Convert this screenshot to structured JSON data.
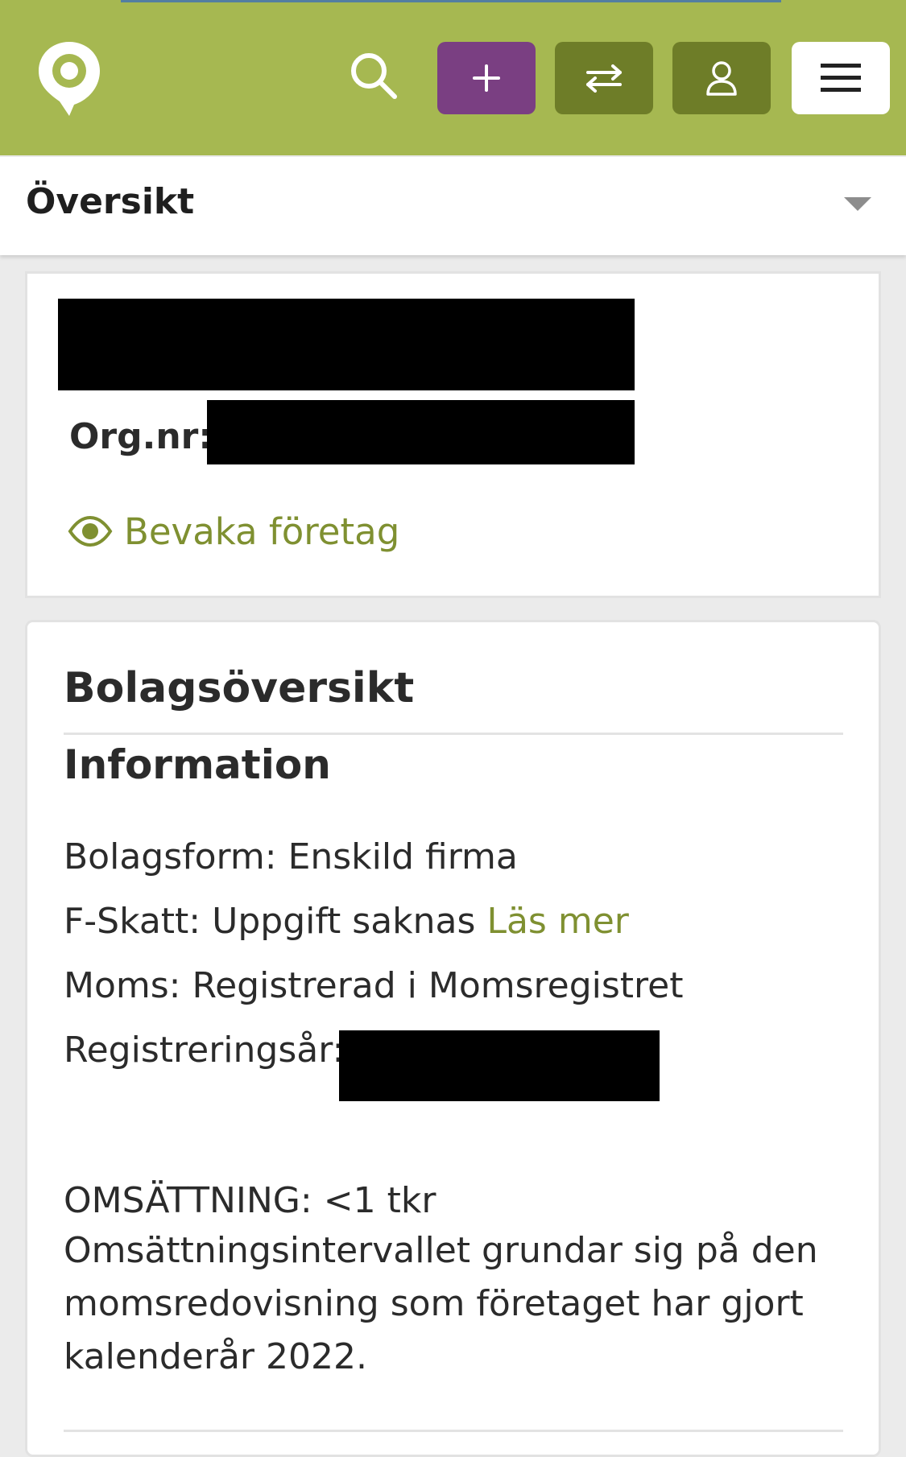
{
  "header": {
    "logo_icon": "map-pin-logo-icon",
    "search_icon": "search-icon",
    "add_icon": "plus-icon",
    "compare_icon": "swap-arrows-icon",
    "account_icon": "user-icon",
    "menu_icon": "hamburger-menu-icon",
    "colors": {
      "bar": "#a6b851",
      "add": "#7a3f82",
      "dark_green": "#6e7d28"
    }
  },
  "section_nav": {
    "title": "Översikt"
  },
  "company_card": {
    "org_label": "Org.nr:",
    "watch_label": "Bevaka företag",
    "watch_icon": "eye-icon"
  },
  "overview": {
    "title": "Bolagsöversikt",
    "info_title": "Information",
    "rows": [
      {
        "label": "Bolagsform:",
        "value": "Enskild firma"
      },
      {
        "label": "F-Skatt:",
        "value": "Uppgift saknas",
        "link": "Läs mer"
      },
      {
        "label": "Moms:",
        "value": "Registrerad i Momsregistret"
      },
      {
        "label": "Registreringsår:",
        "value": ""
      }
    ],
    "turnover": {
      "label": "OMSÄTTNING:",
      "value": "<1 tkr",
      "note": "Omsättningsintervallet grundar sig på den momsredovisning som företaget har gjort kalenderår 2022."
    }
  }
}
